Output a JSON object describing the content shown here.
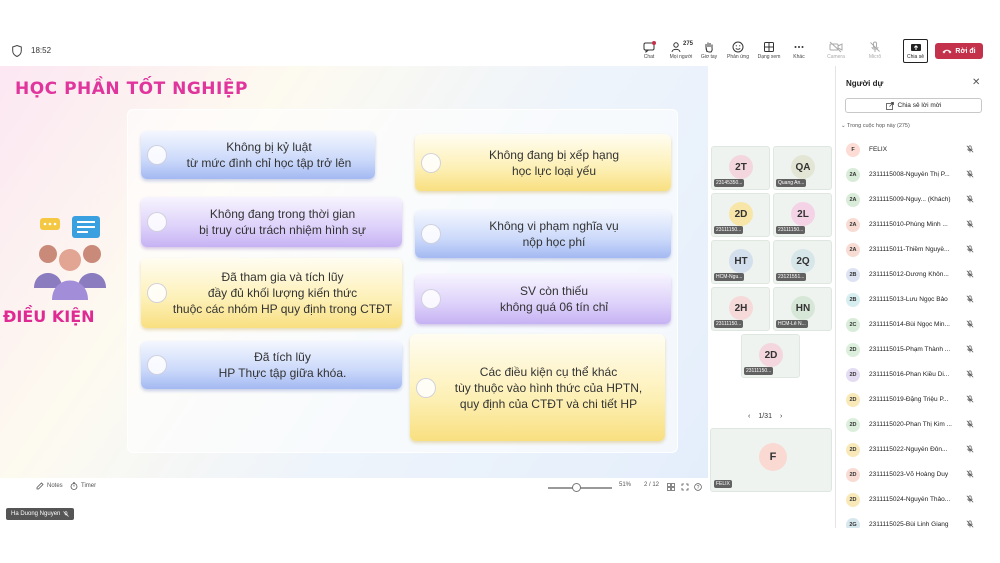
{
  "topbar": {
    "time": "18:52",
    "participant_count": "275",
    "buttons": [
      {
        "id": "chat",
        "label": "Chat",
        "icon": "chat-icon"
      },
      {
        "id": "people",
        "label": "Mọi người",
        "icon": "people-icon"
      },
      {
        "id": "raise",
        "label": "Giơ tay",
        "icon": "raise-hand-icon"
      },
      {
        "id": "react",
        "label": "Phản ứng",
        "icon": "reaction-icon"
      },
      {
        "id": "view",
        "label": "Dạng xem",
        "icon": "view-icon"
      },
      {
        "id": "more",
        "label": "Khác",
        "icon": "more-icon"
      },
      {
        "id": "camera",
        "label": "Camera",
        "icon": "camera-icon"
      },
      {
        "id": "mic",
        "label": "Micrô",
        "icon": "mic-icon"
      }
    ],
    "share_label": "Chia sẻ",
    "leave_label": "Rời đi"
  },
  "slide": {
    "title": "HỌC PHẦN TỐT NGHIỆP",
    "section_label": "ĐIỀU KIỆN",
    "cards": [
      {
        "lines": [
          "Không bị kỷ luật",
          "từ mức đình chỉ học tập trở lên"
        ],
        "color": "blue"
      },
      {
        "lines": [
          "Không đang bị xếp hạng",
          "học lực loại yếu"
        ],
        "color": "yellow"
      },
      {
        "lines": [
          "Không đang trong thời gian",
          "bị truy cứu trách nhiệm hình sự"
        ],
        "color": "purple"
      },
      {
        "lines": [
          "Không vi phạm nghĩa vụ",
          "nộp học phí"
        ],
        "color": "blue"
      },
      {
        "lines": [
          "Đã tham gia và tích lũy",
          "đầy đủ khối lượng kiến thức",
          "thuộc các nhóm HP quy định trong CTĐT"
        ],
        "color": "yellow"
      },
      {
        "lines": [
          "SV còn thiếu",
          "không quá 06 tín chỉ"
        ],
        "color": "purple"
      },
      {
        "lines": [
          "Đã tích lũy",
          "HP Thực tập giữa khóa."
        ],
        "color": "blue"
      },
      {
        "lines": [
          "Các điều kiện cụ thể khác",
          "tùy thuộc vào hình thức của HPTN,",
          "quy định của CTĐT và chi tiết HP"
        ],
        "color": "yellow"
      }
    ]
  },
  "bottombar": {
    "notes_label": "Notes",
    "timer_label": "Timer",
    "zoom": "51%",
    "page": "2 / 12"
  },
  "presenter_name": "Ha Duong Nguyen",
  "tiles": [
    {
      "initials": "2T",
      "name": "23145350...",
      "color": "#f4d7de"
    },
    {
      "initials": "QA",
      "name": "Quang An...",
      "color": "#e3e6d4"
    },
    {
      "initials": "2D",
      "name": "23111150...",
      "color": "#f8e6a8"
    },
    {
      "initials": "2L",
      "name": "23111150...",
      "color": "#f5d3e6"
    },
    {
      "initials": "HT",
      "name": "HCM-Ngu...",
      "color": "#d4dfee"
    },
    {
      "initials": "2Q",
      "name": "23121551...",
      "color": "#d6e6e9"
    },
    {
      "initials": "2H",
      "name": "23111150...",
      "color": "#f6d9d9"
    },
    {
      "initials": "HN",
      "name": "HCM-Lê N...",
      "color": "#d7e7d7"
    },
    {
      "initials": "2D",
      "name": "23111150...",
      "color": "#f3d6de"
    }
  ],
  "tile_pager": "1/31",
  "felix_tile": {
    "initials": "F",
    "name": "FELIX",
    "color": "#fad9d3"
  },
  "side_panel": {
    "title": "Người dự",
    "share_invite_label": "Chia sẻ lời mời",
    "section_label": "Trong cuộc họp này (275)",
    "participants": [
      {
        "initials": "F",
        "name": "FELIX",
        "color": "#fcdcd4"
      },
      {
        "initials": "2A",
        "name": "2311115008-Nguyễn Thị P...",
        "color": "#d9ecd9"
      },
      {
        "initials": "2A",
        "name": "2311115009-Nguy... (Khách)",
        "color": "#d9ecd9"
      },
      {
        "initials": "2A",
        "name": "2311115010-Phùng Minh ...",
        "color": "#f8dcd4"
      },
      {
        "initials": "2A",
        "name": "2311115011-Thiềm Nguyễ...",
        "color": "#f8dcd4"
      },
      {
        "initials": "2B",
        "name": "2311115012-Dương Khôn...",
        "color": "#dde3f3"
      },
      {
        "initials": "2B",
        "name": "2311115013-Lưu Ngọc Bảo",
        "color": "#d7eef0"
      },
      {
        "initials": "2C",
        "name": "2311115014-Bùi Ngọc Min...",
        "color": "#d9ecd9"
      },
      {
        "initials": "2D",
        "name": "2311115015-Phạm Thành ...",
        "color": "#dcefdc"
      },
      {
        "initials": "2D",
        "name": "2311115016-Phan Kiều Di...",
        "color": "#e4dcf3"
      },
      {
        "initials": "2D",
        "name": "2311115019-Đặng Triệu P...",
        "color": "#f9e9b8"
      },
      {
        "initials": "2D",
        "name": "2311115020-Phan Thị Kim ...",
        "color": "#dcefdc"
      },
      {
        "initials": "2D",
        "name": "2311115022-Nguyễn Đôn...",
        "color": "#f9e9b8"
      },
      {
        "initials": "2D",
        "name": "2311115023-Võ Hoàng Duy",
        "color": "#f8dcd4"
      },
      {
        "initials": "2D",
        "name": "2311115024-Nguyễn Thảo...",
        "color": "#f9e9b8"
      },
      {
        "initials": "2G",
        "name": "2311115025-Bùi Linh Giang",
        "color": "#d7e7ee"
      }
    ]
  }
}
